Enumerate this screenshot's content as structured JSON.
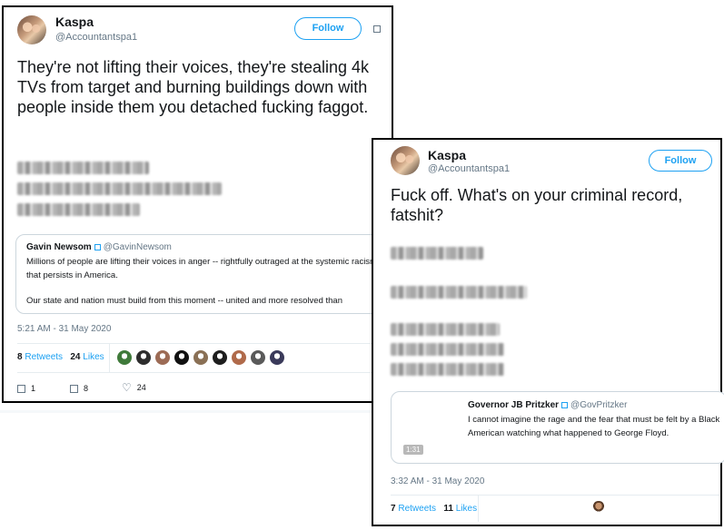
{
  "tweet1": {
    "author_name": "Kaspa",
    "author_handle": "@Accountantspa1",
    "follow_label": "Follow",
    "text": "They're not lifting their voices, they're stealing 4k TVs from target and burning buildings down with people inside them you detached fucking faggot.",
    "redacted_lines": [
      "[address line 1 blurred]",
      "[address line 2 blurred]",
      "[phone blurred]"
    ],
    "quote": {
      "name": "Gavin Newsom",
      "handle": "@GavinNewsom",
      "text_line1": "Millions of people are lifting their voices in anger -- rightfully outraged at the systemic racism that persists in America.",
      "text_line2": "Our state and nation must build from this moment -- united and more resolved than"
    },
    "timestamp": "5:21 AM - 31 May 2020",
    "retweets_count": "8",
    "retweets_label": "Retweets",
    "likes_count": "24",
    "likes_label": "Likes",
    "actions": {
      "reply_count": "1",
      "retweet_count": "8",
      "like_count": "24"
    },
    "liker_colors": [
      "#3f7a3a",
      "#2d2d2d",
      "#9c6b55",
      "#111111",
      "#8a7055",
      "#1e1e1e",
      "#b06a4a",
      "#5a5a5a",
      "#3a3a5a"
    ]
  },
  "tweet2": {
    "author_name": "Kaspa",
    "author_handle": "@Accountantspa1",
    "follow_label": "Follow",
    "text": "Fuck off. What's on your criminal record, fatshit?",
    "redacted_lines": [
      "[address line 1 blurred]",
      "[address line 2 blurred]",
      "[phone 1 blurred]",
      "[phone 2 blurred]",
      "[phone 3 blurred]"
    ],
    "quote": {
      "name": "Governor JB Pritzker",
      "handle": "@GovPritzker",
      "text": "I cannot imagine the rage and the fear that must be felt by a Black American watching what happened to George Floyd.",
      "video_duration": "1:31"
    },
    "timestamp": "3:32 AM - 31 May 2020",
    "retweets_count": "7",
    "retweets_label": "Retweets",
    "likes_count": "11",
    "likes_label": "Likes"
  }
}
